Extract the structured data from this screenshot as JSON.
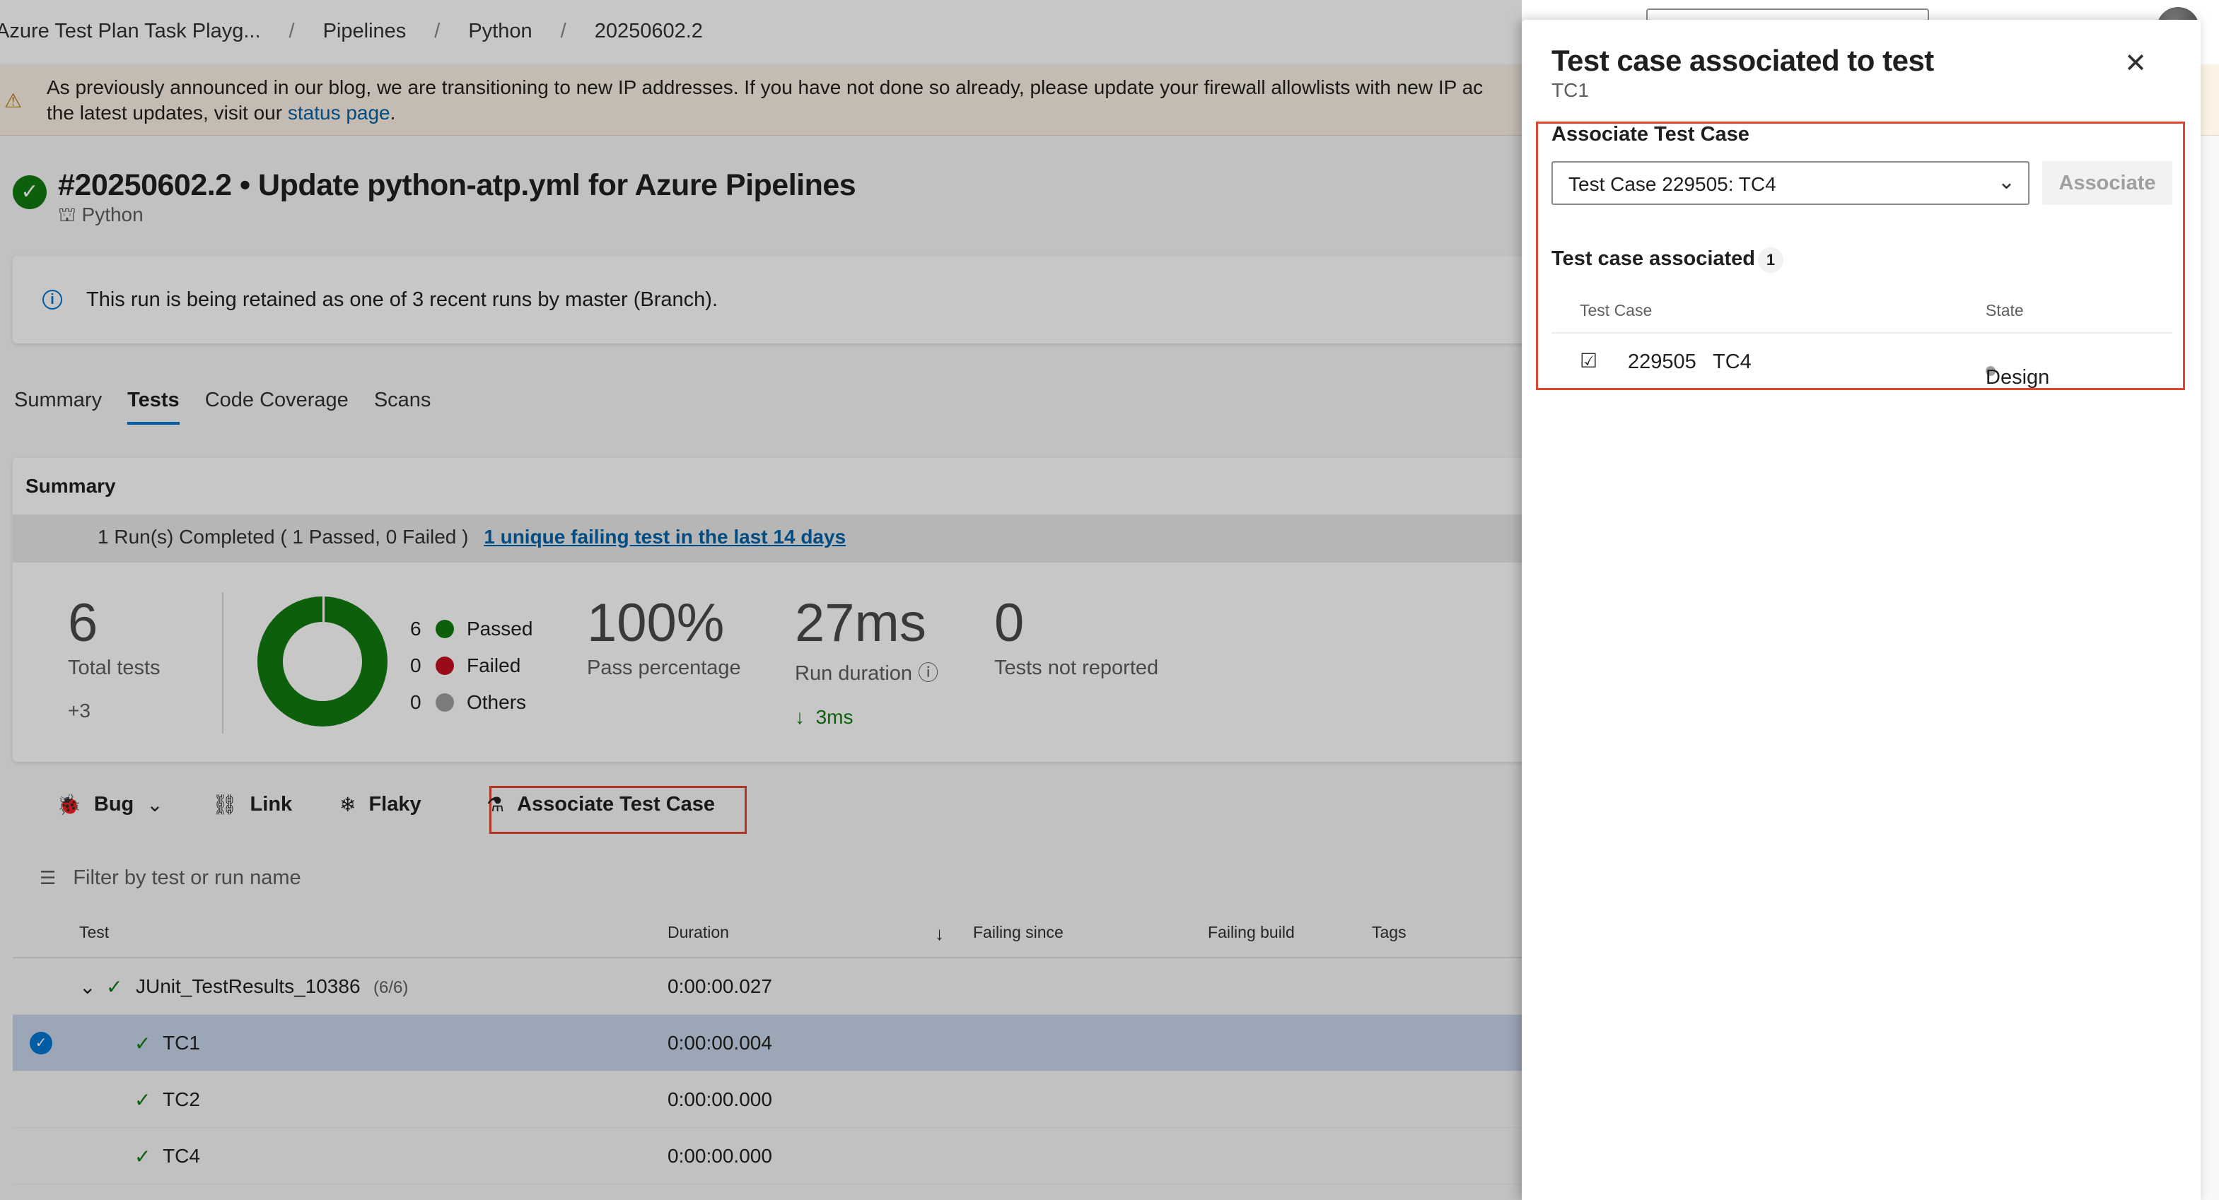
{
  "breadcrumb": [
    "Azure Test Plan Task Playg...",
    "Pipelines",
    "Python",
    "20250602.2"
  ],
  "banner": {
    "text": "As previously announced in our blog, we are transitioning to new IP addresses. If you have not done so already, please update your firewall allowlists with new IP ac",
    "text2": "the latest updates, visit our ",
    "link": "status page",
    "end": "."
  },
  "run": {
    "title": "#20250602.2 • Update python-atp.yml for Azure Pipelines",
    "pipeline": "Python",
    "status": "succeeded"
  },
  "retention": {
    "text": "This run is being retained as one of 3 recent runs by master (Branch)."
  },
  "tabs": [
    {
      "label": "Summary"
    },
    {
      "label": "Tests"
    },
    {
      "label": "Code Coverage"
    },
    {
      "label": "Scans"
    }
  ],
  "summary": {
    "label": "Summary",
    "runs_text": "1 Run(s) Completed ( 1 Passed, 0 Failed )",
    "failing_link": "1 unique failing test in the last 14 days",
    "total_tests": "6",
    "total_label": "Total tests",
    "total_delta": "+3",
    "legend": [
      {
        "count": "6",
        "label": "Passed",
        "color": "#107c10"
      },
      {
        "count": "0",
        "label": "Failed",
        "color": "#c50f1f"
      },
      {
        "count": "0",
        "label": "Others",
        "color": "#a19f9d"
      }
    ],
    "pass_pct": "100%",
    "pass_label": "Pass percentage",
    "duration": "27ms",
    "duration_label": "Run duration",
    "duration_delta": "3ms",
    "not_reported": "0",
    "not_reported_label": "Tests not reported"
  },
  "actions": {
    "bug": "Bug",
    "link": "Link",
    "flaky": "Flaky",
    "associate": "Associate Test Case"
  },
  "filter": {
    "placeholder": "Filter by test or run name"
  },
  "grid": {
    "headers": {
      "test": "Test",
      "duration": "Duration",
      "failing_since": "Failing since",
      "failing_build": "Failing build",
      "tags": "Tags"
    },
    "group": {
      "name": "JUnit_TestResults_10386",
      "count": "(6/6)",
      "duration": "0:00:00.027"
    },
    "rows": [
      {
        "name": "TC1",
        "duration": "0:00:00.004"
      },
      {
        "name": "TC2",
        "duration": "0:00:00.000"
      },
      {
        "name": "TC4",
        "duration": "0:00:00.000"
      }
    ]
  },
  "panel": {
    "title": "Test case associated to test",
    "subtitle": "TC1",
    "section_label": "Associate Test Case",
    "dropdown_value": "Test Case 229505: TC4",
    "associate_button": "Associate",
    "associated_label": "Test case associated",
    "associated_count": "1",
    "table_headers": {
      "test_case": "Test Case",
      "state": "State"
    },
    "associated": [
      {
        "id": "229505",
        "name": "TC4",
        "state": "Design"
      }
    ]
  }
}
